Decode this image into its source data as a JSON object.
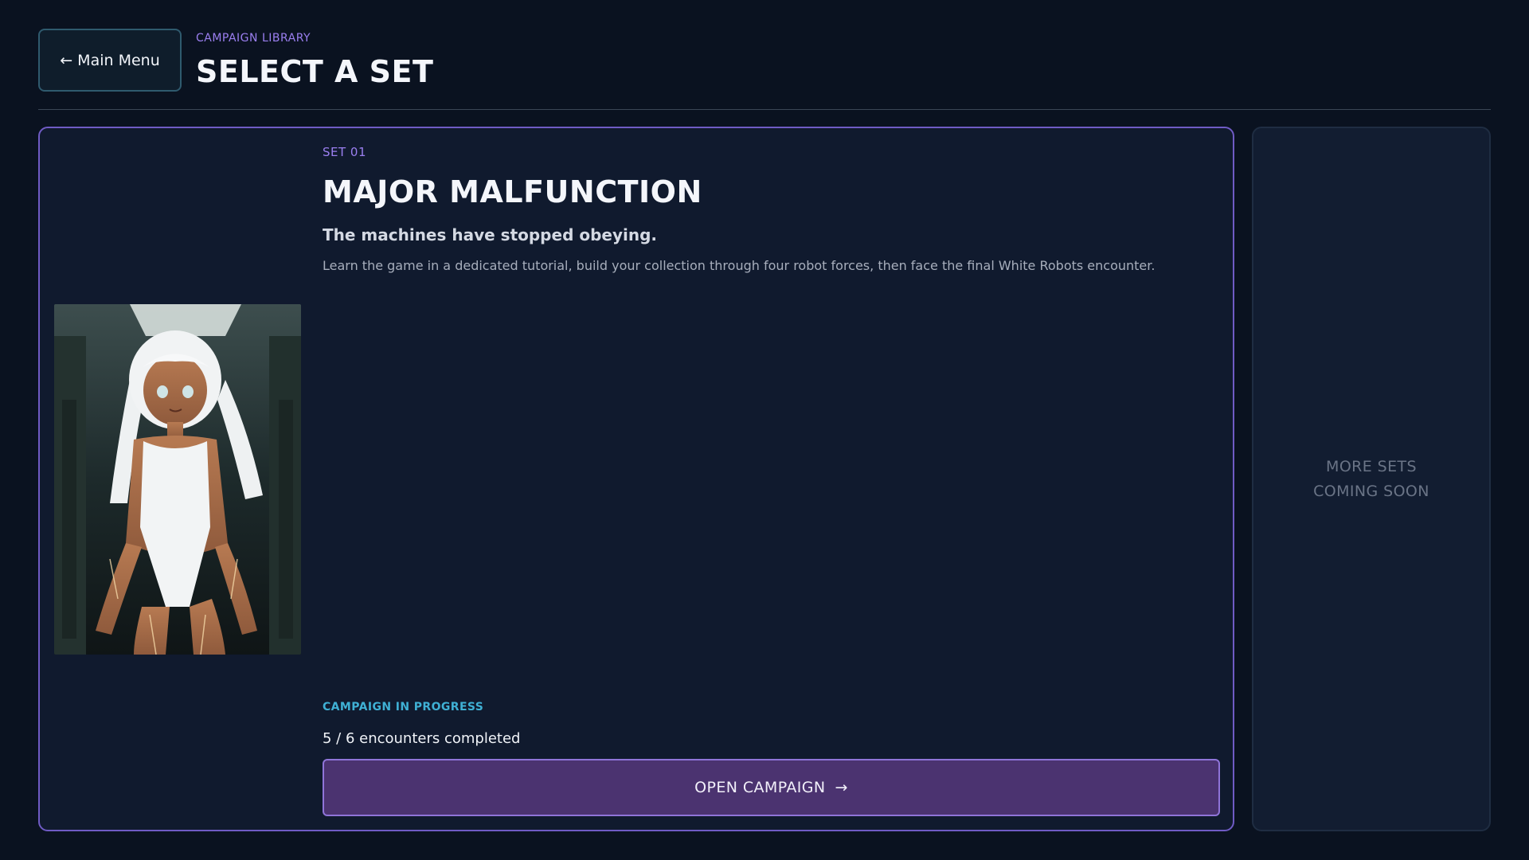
{
  "header": {
    "back_label": "Main Menu",
    "back_arrow": "←",
    "eyebrow": "CAMPAIGN LIBRARY",
    "title": "SELECT A SET"
  },
  "set": {
    "tag": "SET 01",
    "title": "MAJOR MALFUNCTION",
    "tagline": "The machines have stopped obeying.",
    "description": "Learn the game in a dedicated tutorial, build your collection through four robot forces, then face the final White Robots encounter.",
    "status": "CAMPAIGN IN PROGRESS",
    "progress": "5 / 6 encounters completed",
    "progress_completed": 5,
    "progress_total": 6,
    "open_label": "OPEN CAMPAIGN",
    "open_arrow": "→"
  },
  "coming_soon": {
    "text": "MORE SETS\nCOMING SOON"
  },
  "colors": {
    "background": "#0a1220",
    "accent_purple": "#6f5bc4",
    "status_cyan": "#3fb0d4",
    "button_fill": "#4b3370"
  }
}
